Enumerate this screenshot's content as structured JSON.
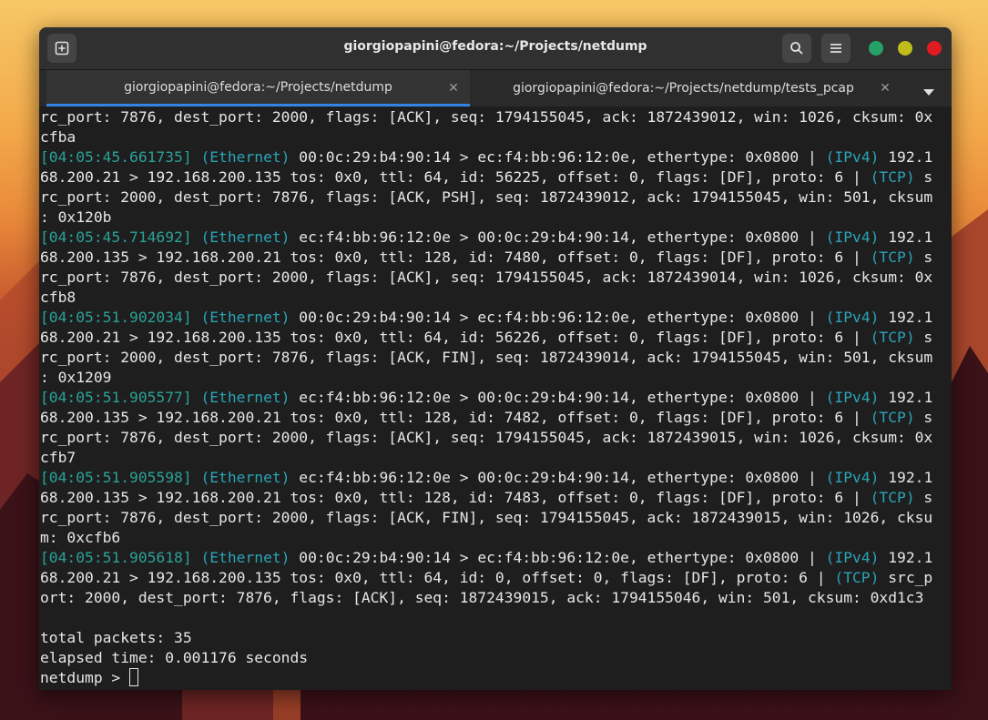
{
  "window": {
    "title": "giorgiopapini@fedora:~/Projects/netdump",
    "buttons": {
      "close_color": "#e01b24",
      "minimize_color": "#c0bc1a",
      "maximize_color": "#26a269"
    }
  },
  "tabs": [
    {
      "label": "giorgiopapini@fedora:~/Projects/netdump",
      "active": true
    },
    {
      "label": "giorgiopapini@fedora:~/Projects/netdump/tests_pcap",
      "active": false
    }
  ],
  "terminal": {
    "top_fragment": [
      "rc_port: 7876, dest_port: 2000, flags: [ACK], seq: 1794155045, ack: 1872439012, win: 1026, cksum: 0x",
      "cfba"
    ],
    "packets": [
      {
        "time": "[04:05:45.661735]",
        "eth": "(Ethernet)",
        "a": " 00:0c:29:b4:90:14 > ec:f4:bb:96:12:0e, ethertype: 0x0800 | ",
        "ip": "(IPv4)",
        "b": " 192.1",
        "c": "68.200.21 > 192.168.200.135 tos: 0x0, ttl: 64, id: 56225, offset: 0, flags: [DF], proto: 6 | ",
        "tcp": "(TCP)",
        "d": " s",
        "rest": [
          "rc_port: 2000, dest_port: 7876, flags: [ACK, PSH], seq: 1872439012, ack: 1794155045, win: 501, cksum",
          ": 0x120b"
        ]
      },
      {
        "time": "[04:05:45.714692]",
        "eth": "(Ethernet)",
        "a": " ec:f4:bb:96:12:0e > 00:0c:29:b4:90:14, ethertype: 0x0800 | ",
        "ip": "(IPv4)",
        "b": " 192.1",
        "c": "68.200.135 > 192.168.200.21 tos: 0x0, ttl: 128, id: 7480, offset: 0, flags: [DF], proto: 6 | ",
        "tcp": "(TCP)",
        "d": " s",
        "rest": [
          "rc_port: 7876, dest_port: 2000, flags: [ACK], seq: 1794155045, ack: 1872439014, win: 1026, cksum: 0x",
          "cfb8"
        ]
      },
      {
        "time": "[04:05:51.902034]",
        "eth": "(Ethernet)",
        "a": " 00:0c:29:b4:90:14 > ec:f4:bb:96:12:0e, ethertype: 0x0800 | ",
        "ip": "(IPv4)",
        "b": " 192.1",
        "c": "68.200.21 > 192.168.200.135 tos: 0x0, ttl: 64, id: 56226, offset: 0, flags: [DF], proto: 6 | ",
        "tcp": "(TCP)",
        "d": " s",
        "rest": [
          "rc_port: 2000, dest_port: 7876, flags: [ACK, FIN], seq: 1872439014, ack: 1794155045, win: 501, cksum",
          ": 0x1209"
        ]
      },
      {
        "time": "[04:05:51.905577]",
        "eth": "(Ethernet)",
        "a": " ec:f4:bb:96:12:0e > 00:0c:29:b4:90:14, ethertype: 0x0800 | ",
        "ip": "(IPv4)",
        "b": " 192.1",
        "c": "68.200.135 > 192.168.200.21 tos: 0x0, ttl: 128, id: 7482, offset: 0, flags: [DF], proto: 6 | ",
        "tcp": "(TCP)",
        "d": " s",
        "rest": [
          "rc_port: 7876, dest_port: 2000, flags: [ACK], seq: 1794155045, ack: 1872439015, win: 1026, cksum: 0x",
          "cfb7"
        ]
      },
      {
        "time": "[04:05:51.905598]",
        "eth": "(Ethernet)",
        "a": " ec:f4:bb:96:12:0e > 00:0c:29:b4:90:14, ethertype: 0x0800 | ",
        "ip": "(IPv4)",
        "b": " 192.1",
        "c": "68.200.135 > 192.168.200.21 tos: 0x0, ttl: 128, id: 7483, offset: 0, flags: [DF], proto: 6 | ",
        "tcp": "(TCP)",
        "d": " s",
        "rest": [
          "rc_port: 7876, dest_port: 2000, flags: [ACK, FIN], seq: 1794155045, ack: 1872439015, win: 1026, cksu",
          "m: 0xcfb6"
        ]
      },
      {
        "time": "[04:05:51.905618]",
        "eth": "(Ethernet)",
        "a": " 00:0c:29:b4:90:14 > ec:f4:bb:96:12:0e, ethertype: 0x0800 | ",
        "ip": "(IPv4)",
        "b": " 192.1",
        "c": "68.200.21 > 192.168.200.135 tos: 0x0, ttl: 64, id: 0, offset: 0, flags: [DF], proto: 6 | ",
        "tcp": "(TCP)",
        "d": " src_p",
        "rest": [
          "ort: 2000, dest_port: 7876, flags: [ACK], seq: 1872439015, ack: 1794155046, win: 501, cksum: 0xd1c3"
        ]
      }
    ],
    "summary": [
      "total packets: 35",
      "elapsed time: 0.001176 seconds"
    ],
    "prompt": "netdump > "
  }
}
